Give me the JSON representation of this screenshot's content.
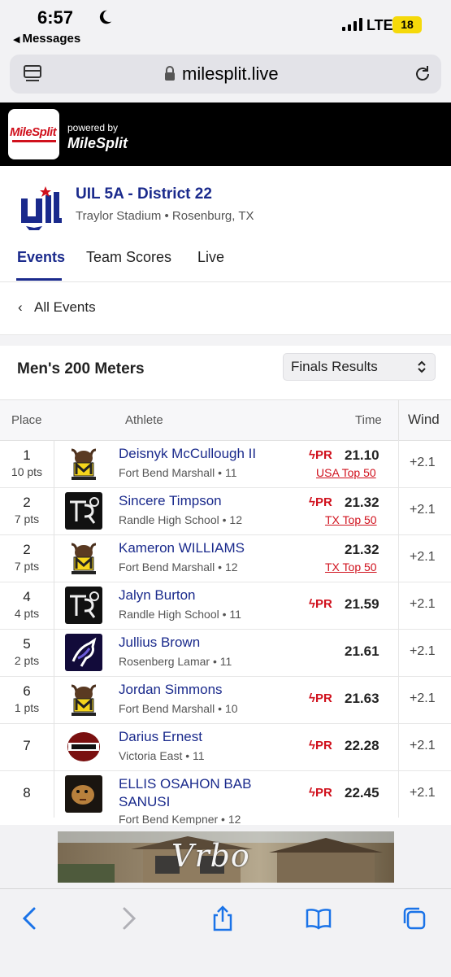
{
  "status_bar": {
    "time": "6:57",
    "back_label": "Messages",
    "network": "LTE",
    "battery": "18"
  },
  "browser": {
    "url": "milesplit.live"
  },
  "brand": {
    "logo_text": "MileSplit",
    "powered_by": "powered by",
    "powered_brand": "MileSplit"
  },
  "meet": {
    "title": "UIL 5A - District 22",
    "venue": "Traylor Stadium • Rosenburg, TX"
  },
  "tabs": [
    {
      "label": "Events",
      "active": true
    },
    {
      "label": "Team Scores",
      "active": false
    },
    {
      "label": "Live",
      "active": false
    }
  ],
  "nav": {
    "back_label": "All Events"
  },
  "event": {
    "title": "Men's 200 Meters",
    "view_select": "Finals Results"
  },
  "table": {
    "headers": {
      "place": "Place",
      "athlete": "Athlete",
      "time": "Time",
      "wind": "Wind"
    },
    "rows": [
      {
        "place": "1",
        "pts": "10 pts",
        "name": "Deisnyk McCullough II",
        "school": "Fort Bend Marshall • 11",
        "pr": "PR",
        "time": "21.10",
        "badge": "USA Top 50",
        "wind": "+2.1",
        "logo": "marshall"
      },
      {
        "place": "2",
        "pts": "7 pts",
        "name": "Sincere Timpson",
        "school": "Randle High School • 12",
        "pr": "PR",
        "time": "21.32",
        "badge": "TX Top 50",
        "wind": "+2.1",
        "logo": "randle"
      },
      {
        "place": "2",
        "pts": "7 pts",
        "name": "Kameron WILLIAMS",
        "school": "Fort Bend Marshall • 12",
        "pr": "",
        "time": "21.32",
        "badge": "TX Top 50",
        "wind": "+2.1",
        "logo": "marshall"
      },
      {
        "place": "4",
        "pts": "4 pts",
        "name": "Jalyn Burton",
        "school": "Randle High School • 11",
        "pr": "PR",
        "time": "21.59",
        "badge": "",
        "wind": "+2.1",
        "logo": "randle"
      },
      {
        "place": "5",
        "pts": "2 pts",
        "name": "Jullius Brown",
        "school": "Rosenberg Lamar • 11",
        "pr": "",
        "time": "21.61",
        "badge": "",
        "wind": "+2.1",
        "logo": "lamar"
      },
      {
        "place": "6",
        "pts": "1 pts",
        "name": "Jordan Simmons",
        "school": "Fort Bend Marshall • 10",
        "pr": "PR",
        "time": "21.63",
        "badge": "",
        "wind": "+2.1",
        "logo": "marshall"
      },
      {
        "place": "7",
        "pts": "",
        "name": "Darius Ernest",
        "school": "Victoria East • 11",
        "pr": "PR",
        "time": "22.28",
        "badge": "",
        "wind": "+2.1",
        "logo": "titans"
      },
      {
        "place": "8",
        "pts": "",
        "name": "ELLIS OSAHON BAB SANUSI",
        "school": "Fort Bend Kempner • 12",
        "pr": "PR",
        "time": "22.45",
        "badge": "",
        "wind": "+2.1",
        "logo": "kempner"
      }
    ]
  },
  "ad": {
    "brand": "Vrbo"
  },
  "colors": {
    "navy": "#1a2a8c",
    "red": "#d0111d",
    "marshall_yellow": "#f5d51c"
  }
}
